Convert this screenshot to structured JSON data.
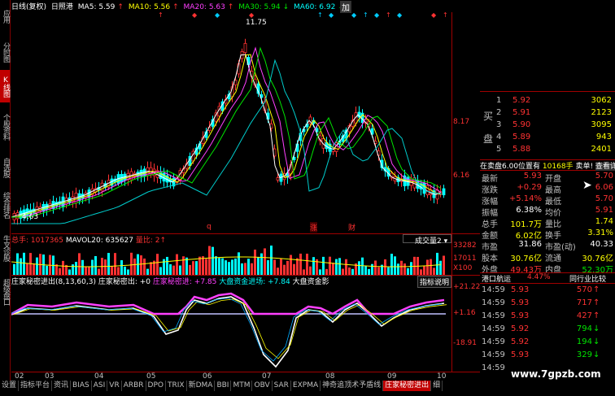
{
  "left_tabs": [
    {
      "label": "应用",
      "active": false
    },
    {
      "label": "分时图",
      "active": false
    },
    {
      "label": "K线图",
      "active": true
    },
    {
      "label": "个股资料",
      "active": false
    },
    {
      "label": "自选股",
      "active": false
    },
    {
      "label": "综合排名",
      "active": false
    },
    {
      "label": "牛叉诊股",
      "active": false
    },
    {
      "label": "超级盘口",
      "active": false
    }
  ],
  "header": {
    "period": "日线(复权)",
    "stock": "日照港",
    "ma5": "MA5: 5.59",
    "ma10": "MA10: 5.56",
    "ma20": "MA20: 5.63",
    "ma30": "MA30: 5.94",
    "ma60": "MA60: 6.92",
    "plus": "加"
  },
  "price_axis": {
    "high": "11.75",
    "low": "4.63",
    "tick1": "8.17",
    "tick2": "6.16"
  },
  "markers": [
    "q",
    "涨",
    "财"
  ],
  "volume": {
    "total": "总手: 1017365",
    "mavol": "MAVOL20: 635627",
    "ratio": "量比: 2",
    "selector": "成交量2",
    "axis_top": "33282",
    "axis_mid": "17011",
    "axis_unit": "X100"
  },
  "indicator": {
    "name": "庄家秘密进出(8,13,60,3)",
    "line1": "庄家秘密出: +0",
    "line2": "庄家秘密进: +7.85",
    "line3": "大盘资金进场: +7.84",
    "line4": "大盘资金影",
    "button": "指标说明",
    "axis_top": "+21.22",
    "axis_mid": "+1.16",
    "axis_low": "-18.91"
  },
  "x_labels": [
    "02",
    "03",
    "04",
    "05",
    "06",
    "07",
    "08",
    "09",
    "10"
  ],
  "bottom_tabs": [
    {
      "label": "设置",
      "active": false
    },
    {
      "label": "指标平台",
      "active": false
    },
    {
      "label": "资讯",
      "active": false
    },
    {
      "label": "BIAS",
      "active": false
    },
    {
      "label": "ASI",
      "active": false
    },
    {
      "label": "VR",
      "active": false
    },
    {
      "label": "ARBR",
      "active": false
    },
    {
      "label": "DPO",
      "active": false
    },
    {
      "label": "TRIX",
      "active": false
    },
    {
      "label": "新DMA",
      "active": false
    },
    {
      "label": "BBI",
      "active": false
    },
    {
      "label": "MTM",
      "active": false
    },
    {
      "label": "OBV",
      "active": false
    },
    {
      "label": "SAR",
      "active": false
    },
    {
      "label": "EXPMA",
      "active": false
    },
    {
      "label": "神奇追顶术予盾线",
      "active": false
    },
    {
      "label": "庄家秘密进出",
      "active": true
    },
    {
      "label": "细",
      "active": false
    }
  ],
  "order_book": {
    "side_label_1": "买",
    "side_label_2": "盘",
    "rows": [
      {
        "level": "1",
        "price": "5.92",
        "vol": "3062"
      },
      {
        "level": "2",
        "price": "5.91",
        "vol": "2123"
      },
      {
        "level": "3",
        "price": "5.90",
        "vol": "3095"
      },
      {
        "level": "4",
        "price": "5.89",
        "vol": "943"
      },
      {
        "level": "5",
        "price": "5.88",
        "vol": "2401"
      }
    ],
    "summary": "在卖盘6.00位置有",
    "summary2": "10168手",
    "summary3": "卖单!",
    "summary4": "查看详细"
  },
  "quote": [
    {
      "k1": "最新",
      "v1": "5.93",
      "c1": "red",
      "k2": "开盘",
      "v2": "5.70",
      "c2": "red"
    },
    {
      "k1": "涨跌",
      "v1": "+0.29",
      "c1": "red",
      "k2": "最高",
      "v2": "6.06",
      "c2": "red"
    },
    {
      "k1": "涨幅",
      "v1": "+5.14%",
      "c1": "red",
      "k2": "最低",
      "v2": "5.70",
      "c2": "red"
    },
    {
      "k1": "振幅",
      "v1": "6.38%",
      "c1": "white",
      "k2": "均价",
      "v2": "5.91",
      "c2": "red"
    },
    {
      "k1": "总手",
      "v1": "101.7万",
      "c1": "yellow",
      "k2": "量比",
      "v2": "1.74",
      "c2": "yellow"
    },
    {
      "k1": "金额",
      "v1": "6.02亿",
      "c1": "yellow",
      "k2": "换手",
      "v2": "3.31%",
      "c2": "yellow"
    },
    {
      "k1": "市盈",
      "v1": "31.86",
      "c1": "white",
      "k2": "市盈(动)",
      "v2": "40.33",
      "c2": "white"
    },
    {
      "k1": "股本",
      "v1": "30.76亿",
      "c1": "yellow",
      "k2": "流通",
      "v2": "30.76亿",
      "c2": "yellow"
    },
    {
      "k1": "外盘",
      "v1": "49.43万",
      "c1": "red",
      "k2": "内盘",
      "v2": "52.30万",
      "c2": "green"
    }
  ],
  "trade_header": {
    "stock": "港口航运",
    "pct": "4.47%",
    "compare": "同行业比较"
  },
  "trades": [
    {
      "time": "14:59",
      "price": "5.93",
      "pc": "red",
      "vol": "570",
      "vc": "red",
      "arrow": "↑",
      "ac": "red"
    },
    {
      "time": "14:59",
      "price": "5.93",
      "pc": "red",
      "vol": "717",
      "vc": "red",
      "arrow": "↑",
      "ac": "red"
    },
    {
      "time": "14:59",
      "price": "5.93",
      "pc": "red",
      "vol": "427",
      "vc": "red",
      "arrow": "↑",
      "ac": "red"
    },
    {
      "time": "14:59",
      "price": "5.92",
      "pc": "red",
      "vol": "794",
      "vc": "green",
      "arrow": "↓",
      "ac": "green"
    },
    {
      "time": "14:59",
      "price": "5.92",
      "pc": "red",
      "vol": "194",
      "vc": "green",
      "arrow": "↓",
      "ac": "green"
    },
    {
      "time": "14:59",
      "price": "5.93",
      "pc": "red",
      "vol": "329",
      "vc": "green",
      "arrow": "↓",
      "ac": "green"
    },
    {
      "time": "14:59",
      "price": "",
      "pc": "red",
      "vol": "",
      "vc": "red",
      "arrow": "",
      "ac": "red"
    }
  ],
  "watermark": "www.7gpzb.com"
}
